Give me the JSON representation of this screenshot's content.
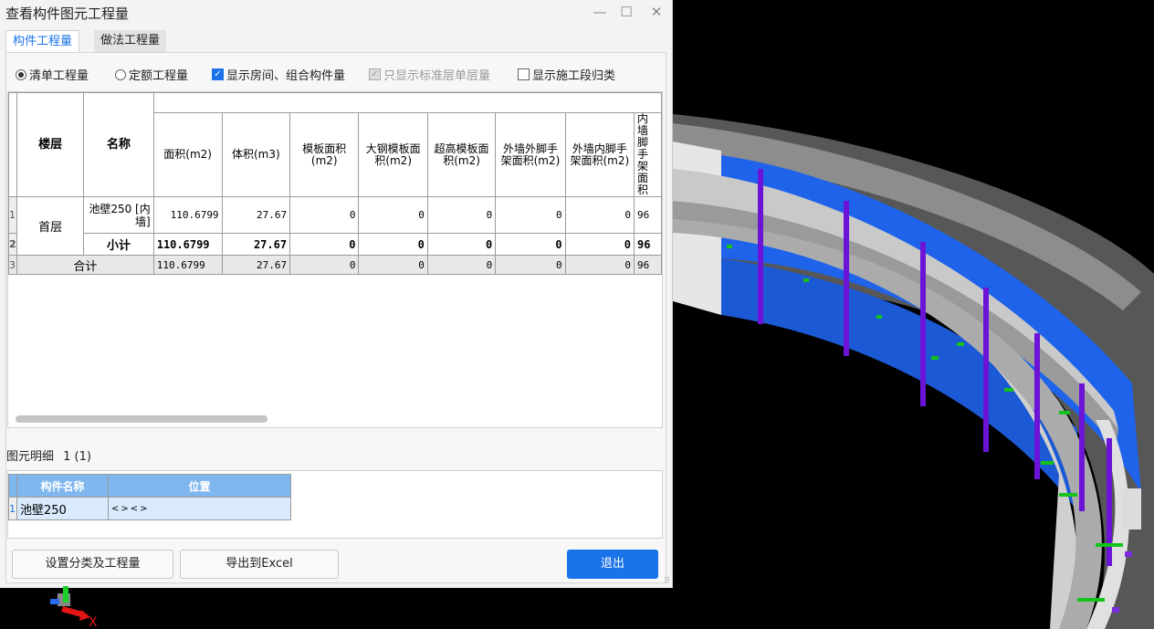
{
  "window": {
    "title": "查看构件图元工程量",
    "minimize": "—",
    "maximize": "☐",
    "close": "✕"
  },
  "tabs": [
    {
      "label": "构件工程量",
      "active": true
    },
    {
      "label": "做法工程量",
      "active": false
    }
  ],
  "options": {
    "radio_list": "清单工程量",
    "radio_quota": "定额工程量",
    "show_rooms": "显示房间、组合构件量",
    "std_floor_only": "只显示标准层单层量",
    "show_stages": "显示施工段归类",
    "selected_radio": "清单工程量",
    "show_rooms_checked": true,
    "std_floor_only_checked": true,
    "std_floor_only_disabled": true,
    "show_stages_checked": false
  },
  "table": {
    "headers": [
      "楼层",
      "名称",
      "面积(m2)",
      "体积(m3)",
      "模板面积(m2)",
      "大钢模板面积(m2)",
      "超高模板面积(m2)",
      "外墙外脚手架面积(m2)",
      "外墙内脚手架面积(m2)",
      "内墙脚手架面积"
    ],
    "row_numbers": [
      "1",
      "2",
      "3"
    ],
    "floor": "首层",
    "rows": [
      {
        "name": "池壁250 [内墙]",
        "values": [
          "110.6799",
          "27.67",
          "0",
          "0",
          "0",
          "0",
          "0",
          "96"
        ]
      },
      {
        "name": "小计",
        "values": [
          "110.6799",
          "27.67",
          "0",
          "0",
          "0",
          "0",
          "0",
          "96"
        ]
      },
      {
        "name": "合计",
        "values": [
          "110.6799",
          "27.67",
          "0",
          "0",
          "0",
          "0",
          "0",
          "96"
        ]
      }
    ]
  },
  "detail": {
    "label": "图元明细",
    "count": "1 (1)",
    "headers": [
      "构件名称",
      "位置"
    ],
    "rows": [
      {
        "no": "1",
        "name": "池壁250",
        "position": "<><>"
      }
    ]
  },
  "buttons": {
    "settings": "设置分类及工程量",
    "export": "导出到Excel",
    "exit": "退出"
  },
  "colors": {
    "accent": "#1a73e8",
    "wall_blue": "#1f63ea",
    "slab_gray": "#a9a9a9",
    "rebar_purple": "#6b14d8",
    "rebar_green": "#16c21c"
  },
  "axis": {
    "x_label": "X"
  }
}
